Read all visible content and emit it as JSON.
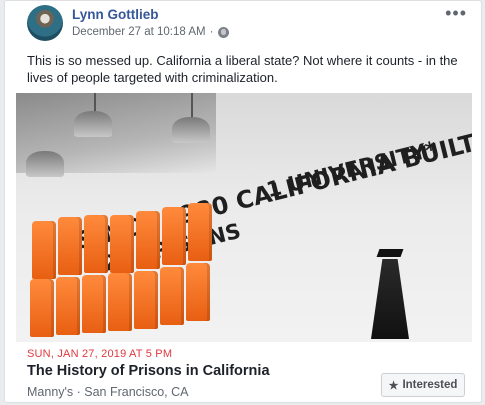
{
  "post": {
    "author": "Lynn Gottlieb",
    "timestamp": "December 27 at 10:18 AM",
    "separator": "·",
    "privacy_icon": "globe-icon",
    "more_icon_glyph": "•••",
    "text": "This is so messed up. California a liberal state? Not where it counts - in the lives of people targeted with criminalization."
  },
  "photo": {
    "wall_line1": "SINCE 1980 CALIFORNIA BUILT",
    "wall_line2": "22 PRISONS",
    "wall_line3": "1 UNIVERSITY*"
  },
  "event": {
    "date": "SUN, JAN 27, 2019 AT 5 PM",
    "title": "The History of Prisons in California",
    "location": "Manny's · San Francisco, CA",
    "interested_label": "Interested",
    "interested_icon_glyph": "★"
  },
  "colors": {
    "author_link": "#365899",
    "event_date": "#e0393e",
    "jumpsuit_orange": "#f47a2f"
  }
}
